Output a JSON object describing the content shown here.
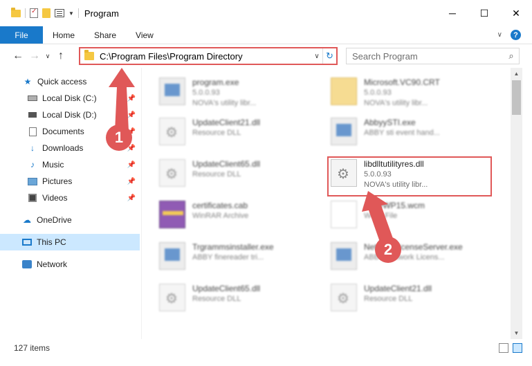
{
  "window": {
    "title": "Program",
    "minimize_label": "─",
    "maximize_label": "☐",
    "close_label": "✕"
  },
  "ribbon": {
    "file_label": "File",
    "tabs": [
      "Home",
      "Share",
      "View"
    ]
  },
  "address": {
    "path": "C:\\Program Files\\Program Directory",
    "search_placeholder": "Search Program"
  },
  "sidebar": {
    "quick_access": "Quick access",
    "items": [
      {
        "label": "Local Disk (C:)",
        "icon": "drive-icon"
      },
      {
        "label": "Local Disk (D:)",
        "icon": "drive-icon"
      },
      {
        "label": "Documents",
        "icon": "documents-icon"
      },
      {
        "label": "Downloads",
        "icon": "downloads-icon"
      },
      {
        "label": "Music",
        "icon": "music-icon"
      },
      {
        "label": "Pictures",
        "icon": "pictures-icon"
      },
      {
        "label": "Videos",
        "icon": "videos-icon"
      }
    ],
    "onedrive": "OneDrive",
    "thispc": "This PC",
    "network": "Network"
  },
  "files": [
    {
      "name": "program.exe",
      "line1": "5.0.0.93",
      "line2": "NOVA's utility libr...",
      "icon": "exe"
    },
    {
      "name": "Microsoft.VC90.CRT",
      "line1": "5.0.0.93",
      "line2": "NOVA's utility libr...",
      "icon": "folder"
    },
    {
      "name": "UpdateClient21.dll",
      "line1": "Resource DLL",
      "line2": "",
      "icon": "dll"
    },
    {
      "name": "AbbyySTI.exe",
      "line1": "ABBY sti event hand...",
      "line2": "",
      "icon": "exe"
    },
    {
      "name": "UpdateClient65.dll",
      "line1": "Resource DLL",
      "line2": "",
      "icon": "dll"
    },
    {
      "name": "libdlltutilityres.dll",
      "line1": "5.0.0.93",
      "line2": "NOVA's utility libr...",
      "icon": "dll"
    },
    {
      "name": "certificates.cab",
      "line1": "WinRAR Archive",
      "line2": "",
      "icon": "cab"
    },
    {
      "name": "AbbyWP15.wcm",
      "line1": "WCM File",
      "line2": "",
      "icon": "wcm"
    },
    {
      "name": "Trgrammsinstaller.exe",
      "line1": "ABBY finereader tri...",
      "line2": "",
      "icon": "exe"
    },
    {
      "name": "NetworkLicenseServer.exe",
      "line1": "ABBY Network Licens...",
      "line2": "",
      "icon": "exe"
    },
    {
      "name": "UpdateClient65.dll",
      "line1": "Resource DLL",
      "line2": "",
      "icon": "dll"
    },
    {
      "name": "UpdateClient21.dll",
      "line1": "Resource DLL",
      "line2": "",
      "icon": "dll"
    }
  ],
  "status": {
    "item_count": "127 items"
  },
  "callouts": {
    "first": "1",
    "second": "2"
  },
  "colors": {
    "accent": "#1979ca",
    "annotation": "#e05858",
    "selected": "#cce8ff"
  }
}
